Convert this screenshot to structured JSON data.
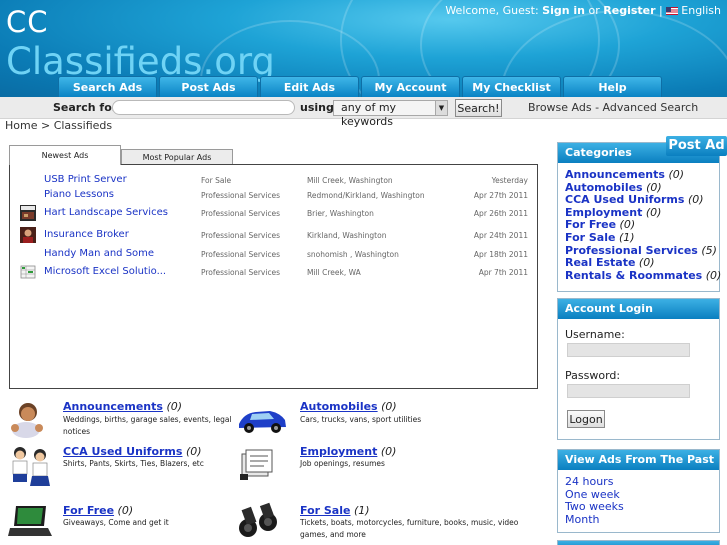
{
  "header": {
    "logo_line1": "CC",
    "logo_line2": "Classifieds.org",
    "welcome_text": "Welcome, Guest:",
    "sign_in": "Sign in",
    "or_text": "or",
    "register": "Register",
    "separator": "|",
    "language": "English"
  },
  "nav": {
    "tabs": [
      {
        "label": "Search Ads"
      },
      {
        "label": "Post Ads"
      },
      {
        "label": "Edit Ads"
      },
      {
        "label": "My Account"
      },
      {
        "label": "My Checklist"
      },
      {
        "label": "Help"
      }
    ]
  },
  "search": {
    "label": "Search for",
    "input_value": "",
    "using_label": "using",
    "mode_selected": "any of my keywords",
    "button_label": "Search!",
    "browse_label": "Browse Ads - Advanced Search"
  },
  "breadcrumb": "Home > Classifieds",
  "tabs": {
    "newest": "Newest Ads",
    "popular": "Most Popular Ads"
  },
  "ads": [
    {
      "title": "USB Print Server",
      "category": "For Sale",
      "location": "Mill Creek, Washington",
      "date": "Yesterday",
      "thumb": ""
    },
    {
      "title": "Piano Lessons",
      "category": "Professional Services",
      "location": "Redmond/Kirkland, Washington",
      "date": "Apr 27th 2011",
      "thumb": ""
    },
    {
      "title": "Hart Landscape Services",
      "category": "Professional Services",
      "location": "Brier, Washington",
      "date": "Apr 26th 2011",
      "thumb": "landscape-thumbnail"
    },
    {
      "title": "Insurance Broker",
      "category": "Professional Services",
      "location": "Kirkland, Washington",
      "date": "Apr 24th 2011",
      "thumb": "person-thumbnail"
    },
    {
      "title": "Handy Man and Some",
      "category": "Professional Services",
      "location": "snohomish , Washington",
      "date": "Apr 18th 2011",
      "thumb": ""
    },
    {
      "title": "Microsoft Excel Solutio...",
      "category": "Professional Services",
      "location": "Mill Creek, WA",
      "date": "Apr 7th 2011",
      "thumb": "spreadsheet-thumbnail"
    }
  ],
  "categories_grid": [
    {
      "name": "Announcements",
      "count": "(0)",
      "desc": "Weddings, births, garage sales, events, legal notices",
      "icon": "baby-icon"
    },
    {
      "name": "Automobiles",
      "count": "(0)",
      "desc": "Cars, trucks, vans, sport utilities",
      "icon": "car-icon"
    },
    {
      "name": "CCA Used Uniforms",
      "count": "(0)",
      "desc": "Shirts, Pants, Skirts, Ties, Blazers, etc",
      "icon": "uniform-icon"
    },
    {
      "name": "Employment",
      "count": "(0)",
      "desc": "Job openings, resumes",
      "icon": "employment-icon"
    },
    {
      "name": "For Free",
      "count": "(0)",
      "desc": "Giveaways, Come and get it",
      "icon": "laptop-icon"
    },
    {
      "name": "For Sale",
      "count": "(1)",
      "desc": "Tickets, boats, motorcycles, furniture, books, music, video games, and more",
      "icon": "binoculars-icon"
    }
  ],
  "sidebar": {
    "post_ad": "Post Ad",
    "categories_title": "Categories",
    "categories": [
      {
        "name": "Announcements",
        "count": "(0)"
      },
      {
        "name": "Automobiles",
        "count": "(0)"
      },
      {
        "name": "CCA Used Uniforms",
        "count": "(0)"
      },
      {
        "name": "Employment",
        "count": "(0)"
      },
      {
        "name": "For Free",
        "count": "(0)"
      },
      {
        "name": "For Sale",
        "count": "(1)"
      },
      {
        "name": "Professional Services",
        "count": "(5)"
      },
      {
        "name": "Real Estate",
        "count": "(0)"
      },
      {
        "name": "Rentals & Roommates",
        "count": "(0)"
      }
    ],
    "login_title": "Account Login",
    "username_label": "Username:",
    "password_label": "Password:",
    "logon_button": "Logon",
    "past_title": "View Ads From The Past",
    "past_links": [
      "24 hours",
      "One week",
      "Two weeks",
      "Month"
    ]
  },
  "colors": {
    "link": "#1a33c5",
    "header_blue": "#0b7cb6",
    "tab_blue": "#1e9ad6"
  }
}
